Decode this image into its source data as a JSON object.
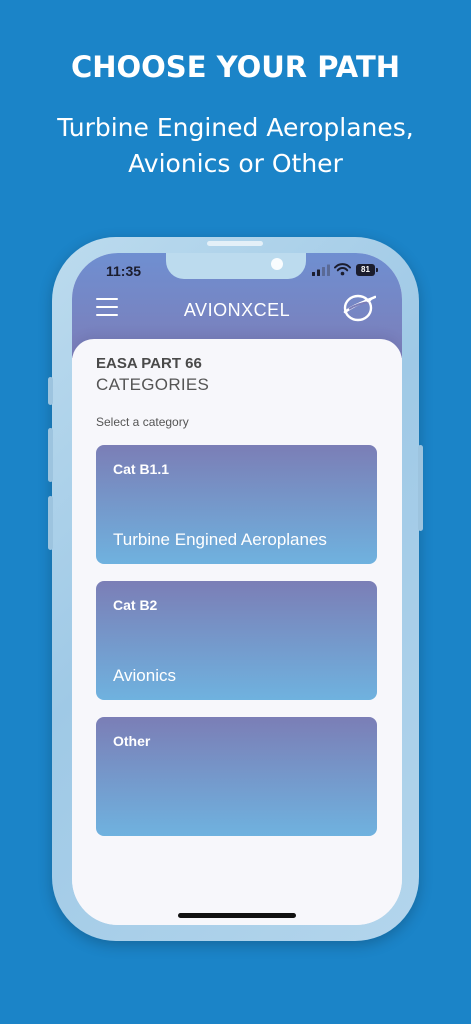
{
  "promo": {
    "title": "CHOOSE YOUR PATH",
    "subtitle_line1": "Turbine Engined Aeroplanes,",
    "subtitle_line2": "Avionics or Other"
  },
  "status_bar": {
    "time": "11:35",
    "battery": "81"
  },
  "header": {
    "app_title": "AVIONXCEL",
    "menu_icon": "hamburger-menu-icon",
    "logo_icon": "plane-globe-logo-icon"
  },
  "section": {
    "title": "EASA PART 66",
    "subtitle": "CATEGORIES",
    "hint": "Select a category"
  },
  "categories": [
    {
      "code": "Cat B1.1",
      "description": "Turbine Engined Aeroplanes"
    },
    {
      "code": "Cat B2",
      "description": "Avionics"
    },
    {
      "code": "Other",
      "description": ""
    }
  ],
  "colors": {
    "background": "#1b84c8",
    "header_top": "#6f8fd1",
    "header_bottom": "#7c7eb9",
    "card_top": "#7b7eb6",
    "card_bottom": "#6fb2df"
  }
}
